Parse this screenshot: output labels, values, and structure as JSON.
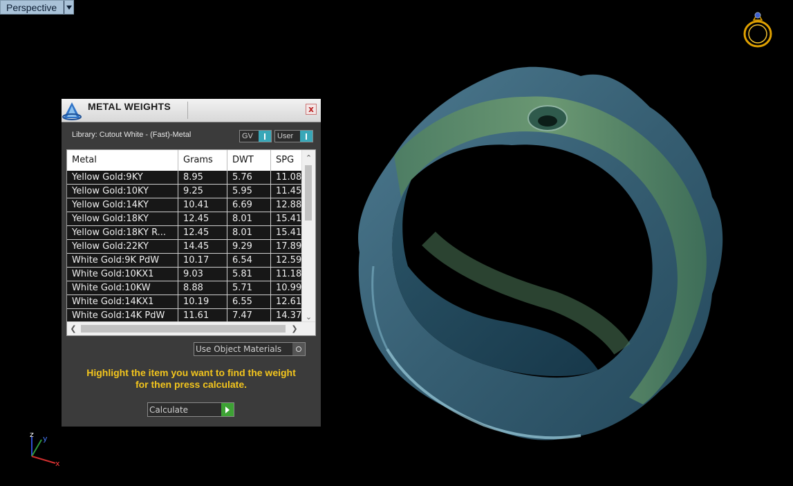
{
  "viewport": {
    "label": "Perspective"
  },
  "dialog": {
    "title": "METAL WEIGHTS",
    "close_label": "x",
    "library": "Library: Cutout White - (Fast)-Metal",
    "gv_label": "GV",
    "user_label": "User",
    "columns": [
      "Metal",
      "Grams",
      "DWT",
      "SPG"
    ],
    "rows": [
      [
        "Yellow Gold:9KY",
        "8.95",
        "5.76",
        "11.08"
      ],
      [
        "Yellow Gold:10KY",
        "9.25",
        "5.95",
        "11.45"
      ],
      [
        "Yellow Gold:14KY",
        "10.41",
        "6.69",
        "12.88"
      ],
      [
        "Yellow Gold:18KY",
        "12.45",
        "8.01",
        "15.41"
      ],
      [
        "Yellow Gold:18KY R...",
        "12.45",
        "8.01",
        "15.41"
      ],
      [
        "Yellow Gold:22KY",
        "14.45",
        "9.29",
        "17.89"
      ],
      [
        "White Gold:9K PdW",
        "10.17",
        "6.54",
        "12.59"
      ],
      [
        "White Gold:10KX1",
        "9.03",
        "5.81",
        "11.18"
      ],
      [
        "White Gold:10KW",
        "8.88",
        "5.71",
        "10.99"
      ],
      [
        "White Gold:14KX1",
        "10.19",
        "6.55",
        "12.61"
      ],
      [
        "White Gold:14K PdW",
        "11.61",
        "7.47",
        "14.37"
      ]
    ],
    "use_object_materials": "Use Object Materials",
    "instruction_line1": "Highlight the item you want to find the weight",
    "instruction_line2": "for then press calculate.",
    "calculate_label": "Calculate"
  },
  "axis": {
    "z": "z",
    "y": "y",
    "x": "x"
  },
  "colors": {
    "accent_teal": "#38a7b8",
    "instruction": "#f3c51d",
    "go_green": "#3da234",
    "viewport_tab": "#a9c2d8"
  }
}
